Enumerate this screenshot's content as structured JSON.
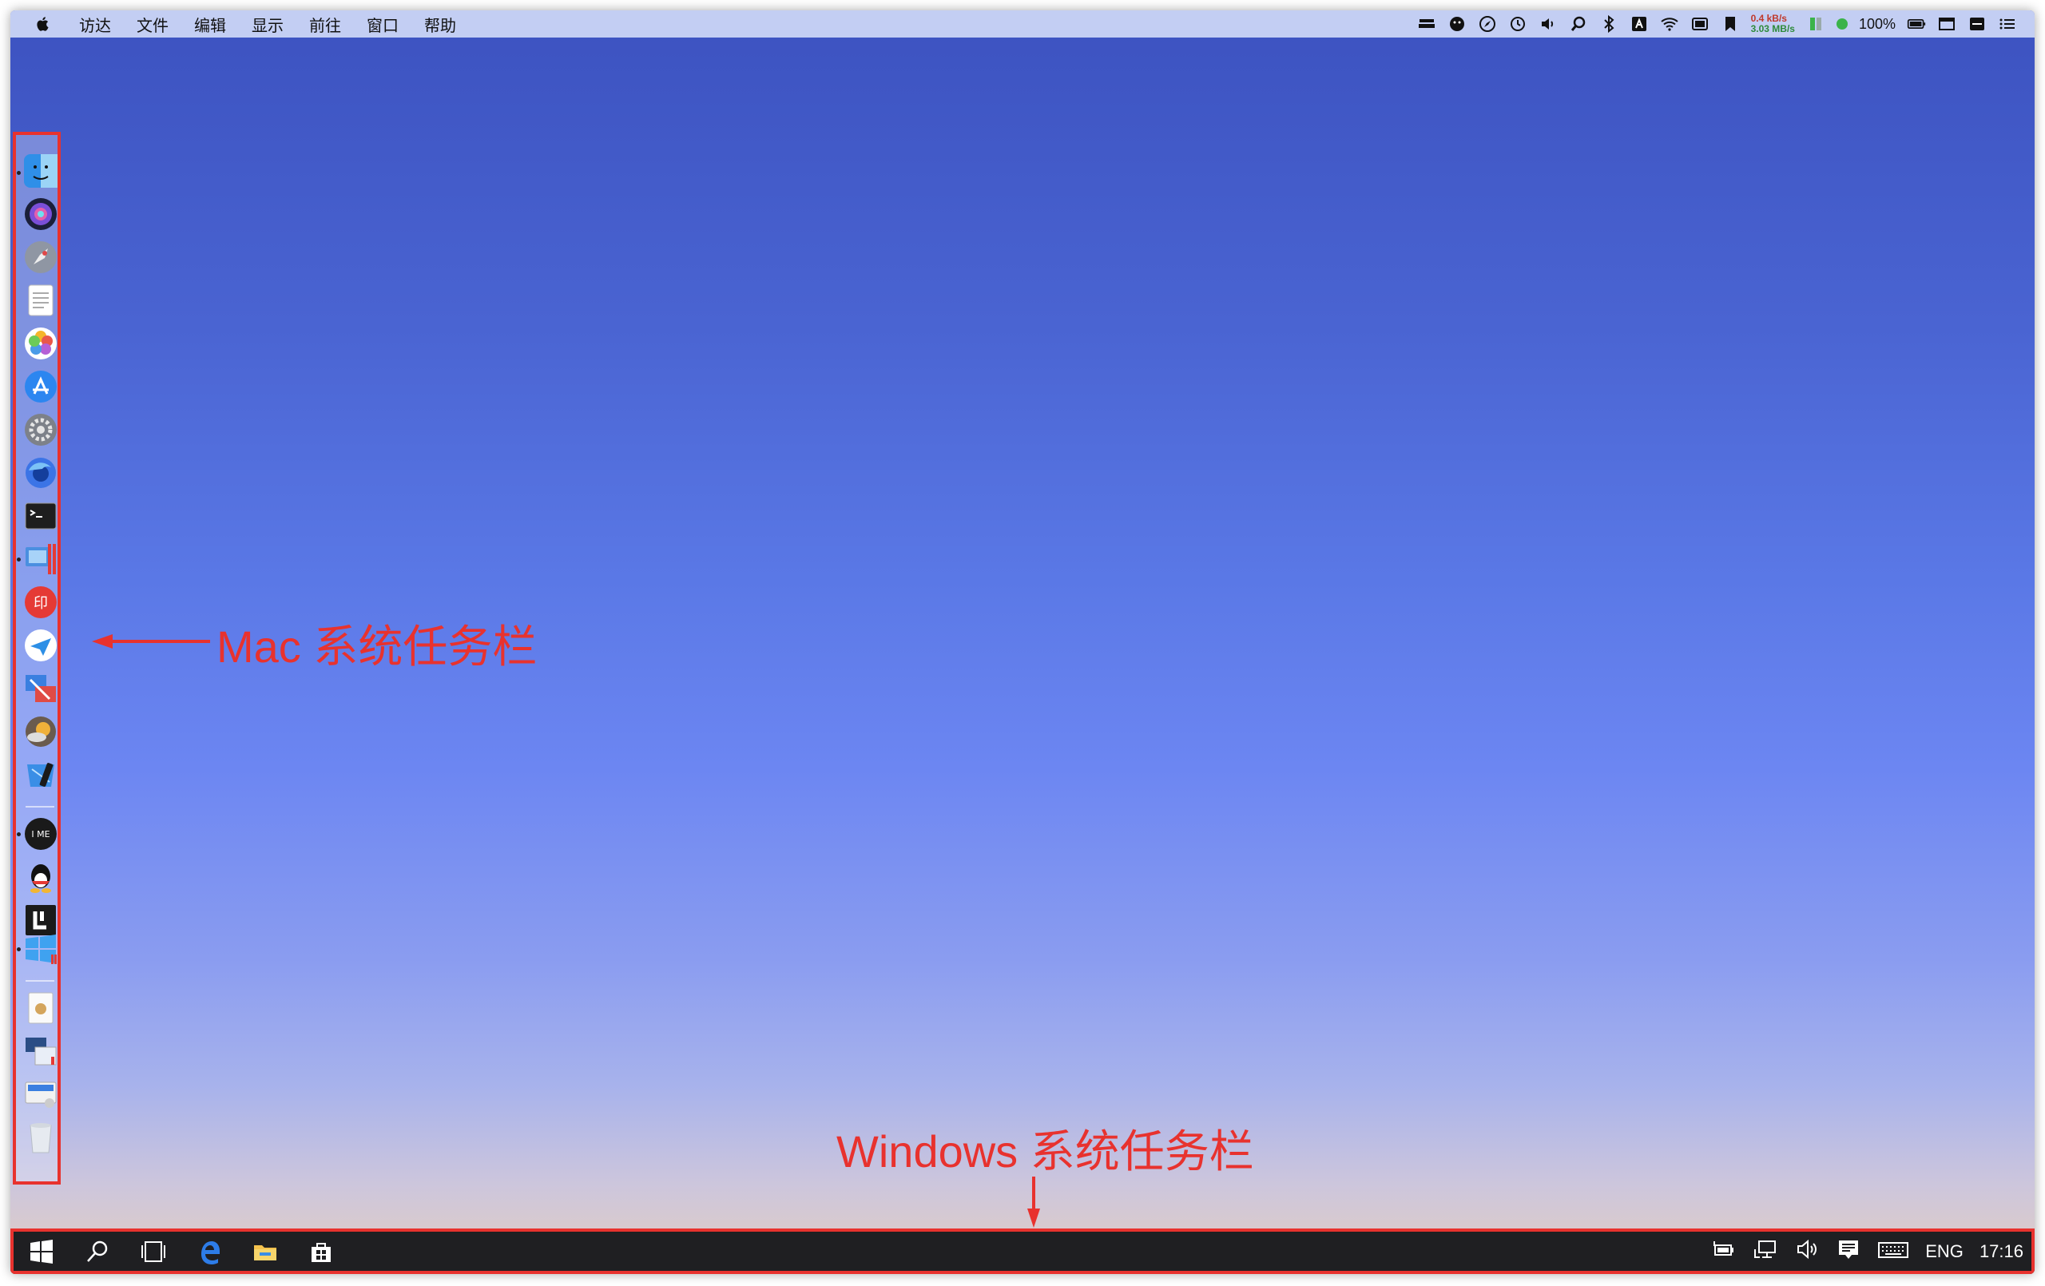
{
  "menubar": {
    "menus": [
      "访达",
      "文件",
      "编辑",
      "显示",
      "前往",
      "窗口",
      "帮助"
    ],
    "net_up": "0.4 kB/s",
    "net_down": "3.03 MB/s",
    "battery": "100%"
  },
  "dock": {
    "apps": [
      "finder-icon",
      "siri-icon",
      "launchpad-icon",
      "notes-icon",
      "photos-icon",
      "app-store-icon",
      "system-preferences-icon",
      "firefox-icon",
      "terminal-icon",
      "parallels-icon",
      "font-app-icon",
      "airmail-icon",
      "remote-desktop-icon",
      "disk-utility-icon",
      "xcode-icon",
      "ime-icon",
      "qq-icon",
      "lasso-icon",
      "windows-icon",
      "preview-icon",
      "screenshot-icon",
      "display-icon",
      "trash-icon"
    ]
  },
  "annotations": {
    "mac_taskbar": "Mac 系统任务栏",
    "windows_taskbar": "Windows 系统任务栏"
  },
  "taskbar": {
    "lang": "ENG",
    "time": "17:16"
  },
  "colors": {
    "annotation_red": "#e8322e",
    "taskbar_bg": "#1f1f22"
  }
}
